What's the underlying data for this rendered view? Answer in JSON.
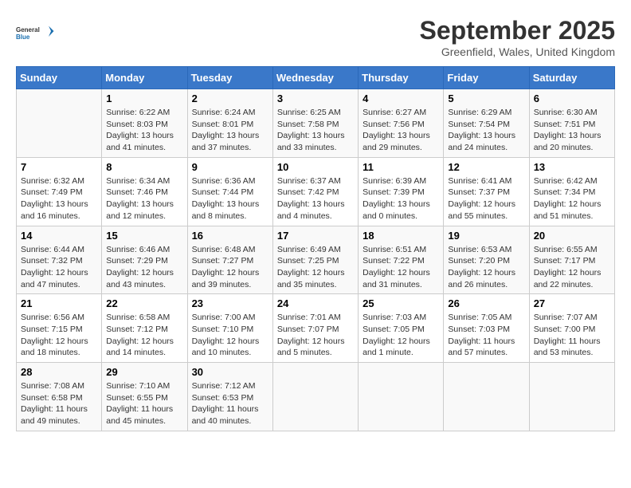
{
  "logo": {
    "line1": "General",
    "line2": "Blue"
  },
  "title": "September 2025",
  "location": "Greenfield, Wales, United Kingdom",
  "days_header": [
    "Sunday",
    "Monday",
    "Tuesday",
    "Wednesday",
    "Thursday",
    "Friday",
    "Saturday"
  ],
  "weeks": [
    [
      {
        "num": "",
        "lines": []
      },
      {
        "num": "1",
        "lines": [
          "Sunrise: 6:22 AM",
          "Sunset: 8:03 PM",
          "Daylight: 13 hours",
          "and 41 minutes."
        ]
      },
      {
        "num": "2",
        "lines": [
          "Sunrise: 6:24 AM",
          "Sunset: 8:01 PM",
          "Daylight: 13 hours",
          "and 37 minutes."
        ]
      },
      {
        "num": "3",
        "lines": [
          "Sunrise: 6:25 AM",
          "Sunset: 7:58 PM",
          "Daylight: 13 hours",
          "and 33 minutes."
        ]
      },
      {
        "num": "4",
        "lines": [
          "Sunrise: 6:27 AM",
          "Sunset: 7:56 PM",
          "Daylight: 13 hours",
          "and 29 minutes."
        ]
      },
      {
        "num": "5",
        "lines": [
          "Sunrise: 6:29 AM",
          "Sunset: 7:54 PM",
          "Daylight: 13 hours",
          "and 24 minutes."
        ]
      },
      {
        "num": "6",
        "lines": [
          "Sunrise: 6:30 AM",
          "Sunset: 7:51 PM",
          "Daylight: 13 hours",
          "and 20 minutes."
        ]
      }
    ],
    [
      {
        "num": "7",
        "lines": [
          "Sunrise: 6:32 AM",
          "Sunset: 7:49 PM",
          "Daylight: 13 hours",
          "and 16 minutes."
        ]
      },
      {
        "num": "8",
        "lines": [
          "Sunrise: 6:34 AM",
          "Sunset: 7:46 PM",
          "Daylight: 13 hours",
          "and 12 minutes."
        ]
      },
      {
        "num": "9",
        "lines": [
          "Sunrise: 6:36 AM",
          "Sunset: 7:44 PM",
          "Daylight: 13 hours",
          "and 8 minutes."
        ]
      },
      {
        "num": "10",
        "lines": [
          "Sunrise: 6:37 AM",
          "Sunset: 7:42 PM",
          "Daylight: 13 hours",
          "and 4 minutes."
        ]
      },
      {
        "num": "11",
        "lines": [
          "Sunrise: 6:39 AM",
          "Sunset: 7:39 PM",
          "Daylight: 13 hours",
          "and 0 minutes."
        ]
      },
      {
        "num": "12",
        "lines": [
          "Sunrise: 6:41 AM",
          "Sunset: 7:37 PM",
          "Daylight: 12 hours",
          "and 55 minutes."
        ]
      },
      {
        "num": "13",
        "lines": [
          "Sunrise: 6:42 AM",
          "Sunset: 7:34 PM",
          "Daylight: 12 hours",
          "and 51 minutes."
        ]
      }
    ],
    [
      {
        "num": "14",
        "lines": [
          "Sunrise: 6:44 AM",
          "Sunset: 7:32 PM",
          "Daylight: 12 hours",
          "and 47 minutes."
        ]
      },
      {
        "num": "15",
        "lines": [
          "Sunrise: 6:46 AM",
          "Sunset: 7:29 PM",
          "Daylight: 12 hours",
          "and 43 minutes."
        ]
      },
      {
        "num": "16",
        "lines": [
          "Sunrise: 6:48 AM",
          "Sunset: 7:27 PM",
          "Daylight: 12 hours",
          "and 39 minutes."
        ]
      },
      {
        "num": "17",
        "lines": [
          "Sunrise: 6:49 AM",
          "Sunset: 7:25 PM",
          "Daylight: 12 hours",
          "and 35 minutes."
        ]
      },
      {
        "num": "18",
        "lines": [
          "Sunrise: 6:51 AM",
          "Sunset: 7:22 PM",
          "Daylight: 12 hours",
          "and 31 minutes."
        ]
      },
      {
        "num": "19",
        "lines": [
          "Sunrise: 6:53 AM",
          "Sunset: 7:20 PM",
          "Daylight: 12 hours",
          "and 26 minutes."
        ]
      },
      {
        "num": "20",
        "lines": [
          "Sunrise: 6:55 AM",
          "Sunset: 7:17 PM",
          "Daylight: 12 hours",
          "and 22 minutes."
        ]
      }
    ],
    [
      {
        "num": "21",
        "lines": [
          "Sunrise: 6:56 AM",
          "Sunset: 7:15 PM",
          "Daylight: 12 hours",
          "and 18 minutes."
        ]
      },
      {
        "num": "22",
        "lines": [
          "Sunrise: 6:58 AM",
          "Sunset: 7:12 PM",
          "Daylight: 12 hours",
          "and 14 minutes."
        ]
      },
      {
        "num": "23",
        "lines": [
          "Sunrise: 7:00 AM",
          "Sunset: 7:10 PM",
          "Daylight: 12 hours",
          "and 10 minutes."
        ]
      },
      {
        "num": "24",
        "lines": [
          "Sunrise: 7:01 AM",
          "Sunset: 7:07 PM",
          "Daylight: 12 hours",
          "and 5 minutes."
        ]
      },
      {
        "num": "25",
        "lines": [
          "Sunrise: 7:03 AM",
          "Sunset: 7:05 PM",
          "Daylight: 12 hours",
          "and 1 minute."
        ]
      },
      {
        "num": "26",
        "lines": [
          "Sunrise: 7:05 AM",
          "Sunset: 7:03 PM",
          "Daylight: 11 hours",
          "and 57 minutes."
        ]
      },
      {
        "num": "27",
        "lines": [
          "Sunrise: 7:07 AM",
          "Sunset: 7:00 PM",
          "Daylight: 11 hours",
          "and 53 minutes."
        ]
      }
    ],
    [
      {
        "num": "28",
        "lines": [
          "Sunrise: 7:08 AM",
          "Sunset: 6:58 PM",
          "Daylight: 11 hours",
          "and 49 minutes."
        ]
      },
      {
        "num": "29",
        "lines": [
          "Sunrise: 7:10 AM",
          "Sunset: 6:55 PM",
          "Daylight: 11 hours",
          "and 45 minutes."
        ]
      },
      {
        "num": "30",
        "lines": [
          "Sunrise: 7:12 AM",
          "Sunset: 6:53 PM",
          "Daylight: 11 hours",
          "and 40 minutes."
        ]
      },
      {
        "num": "",
        "lines": []
      },
      {
        "num": "",
        "lines": []
      },
      {
        "num": "",
        "lines": []
      },
      {
        "num": "",
        "lines": []
      }
    ]
  ]
}
